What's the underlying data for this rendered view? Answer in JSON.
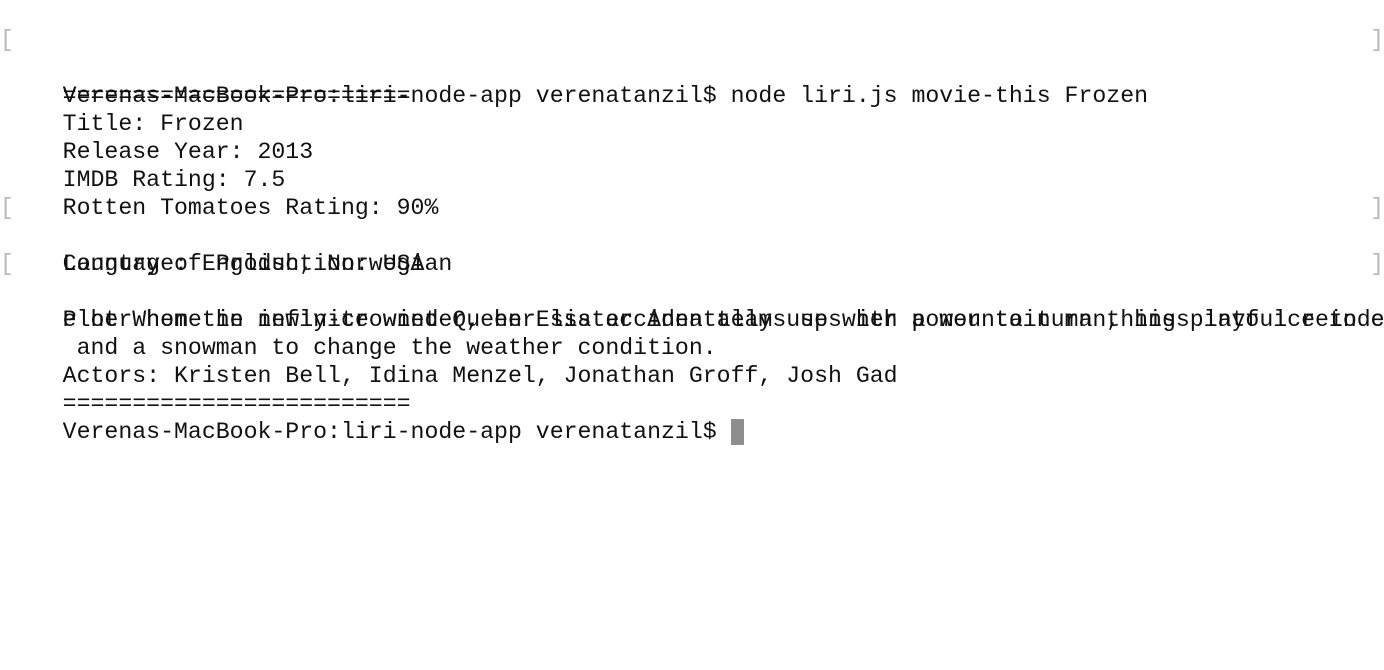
{
  "terminal": {
    "command_line": "Verenas-MacBook-Pro:liri-node-app verenatanzil$ node liri.js movie-this Frozen",
    "separator": "=========================",
    "title_line": "Title: Frozen",
    "year_line": "Release Year: 2013",
    "imdb_line": "IMDB Rating: 7.5",
    "rt_line": "Rotten Tomatoes Rating: 90%",
    "country_line": "Country of Production: USA",
    "language_line": "Language: English, Norwegian",
    "plot_line_1": "Plot When the newly-crowned Queen Elsa accidentally uses her power to turn things into ice to curs",
    "plot_line_2": "e her home in infinite winter, her sister Anna teams up with a mountain man, his playful reindeer,",
    "plot_line_3": " and a snowman to change the weather condition.",
    "actors_line": "Actors: Kristen Bell, Idina Menzel, Jonathan Groff, Josh Gad",
    "prompt": "Verenas-MacBook-Pro:liri-node-app verenatanzil$"
  },
  "marks": {
    "left": "[",
    "right": "]"
  }
}
